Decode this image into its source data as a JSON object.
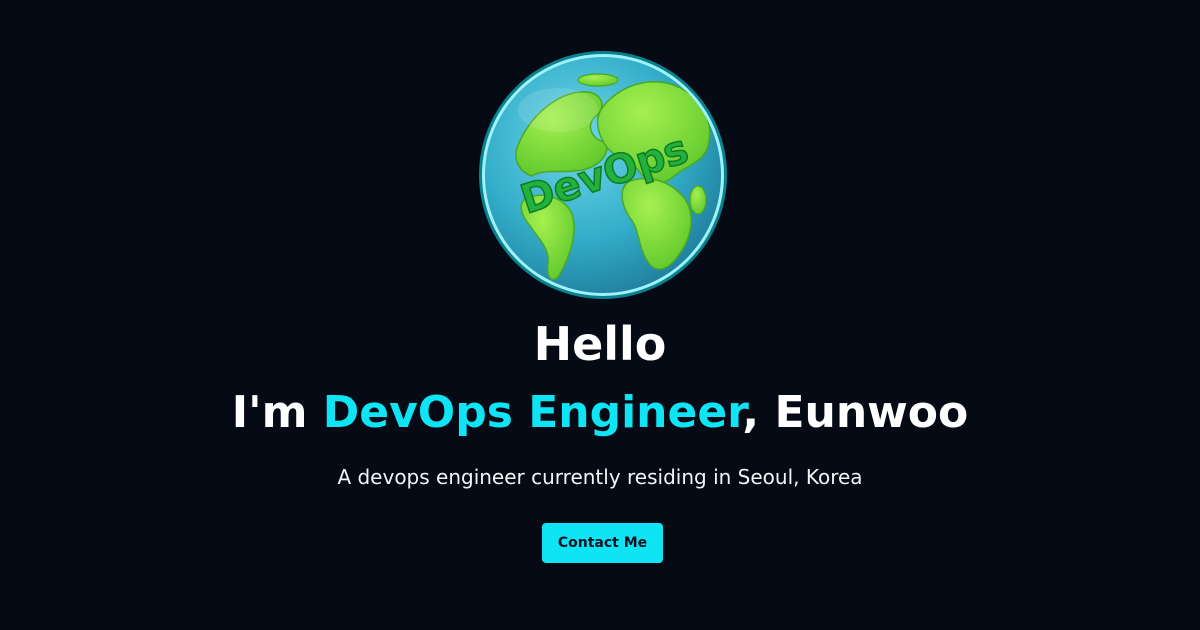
{
  "hero": {
    "avatar": {
      "icon": "devops-globe-icon",
      "label": "DevOps"
    },
    "greeting": "Hello",
    "intro_prefix": "I'm ",
    "role": "DevOps Engineer",
    "intro_suffix": ", Eunwoo",
    "description": "A devops engineer currently residing in Seoul, Korea",
    "contact_label": "Contact Me"
  },
  "colors": {
    "background": "#050a14",
    "accent": "#0fe4f4",
    "text": "#ffffff",
    "globe_ocean": "#35b4cf",
    "globe_land": "#7fe03a"
  }
}
